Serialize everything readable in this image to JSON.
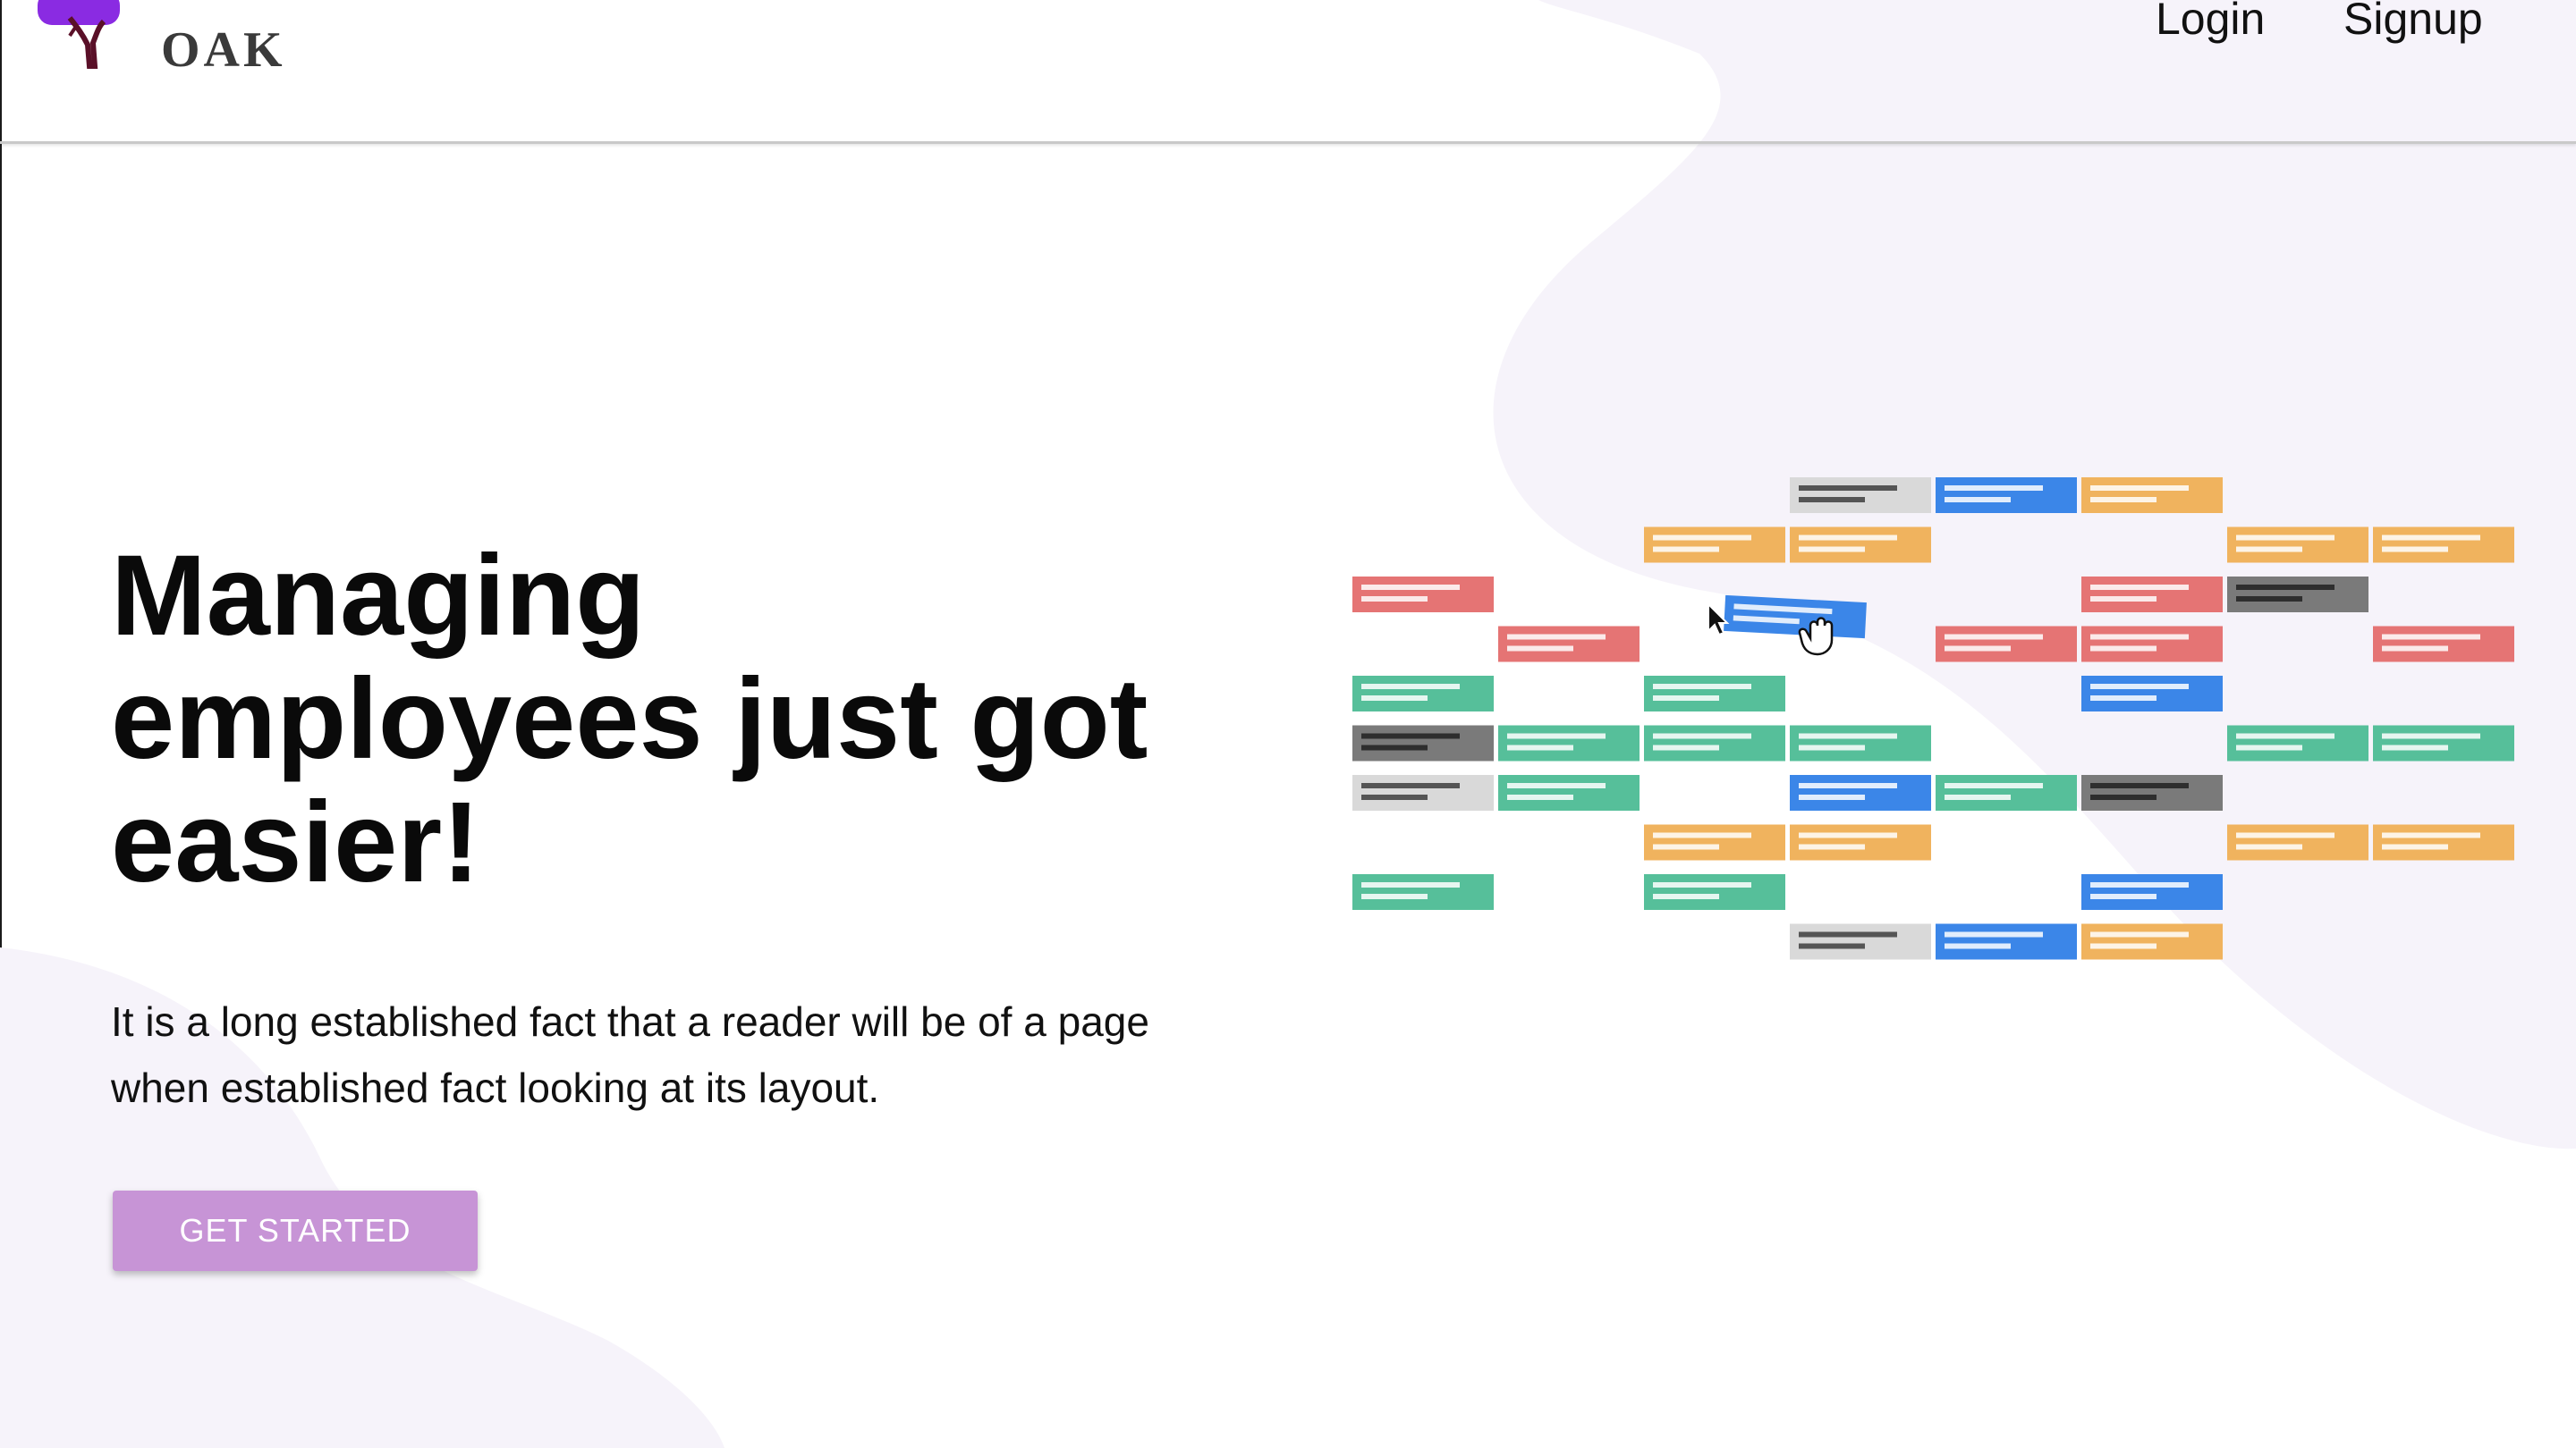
{
  "brand": {
    "name": "OAK",
    "accent_purple": "#8a2be2",
    "trunk_color": "#5a1028"
  },
  "nav": {
    "login_label": "Login",
    "signup_label": "Signup"
  },
  "hero": {
    "headline": "Managing employees just got easier!",
    "subtext": "It is a long established fact that a reader will be of a page when established fact looking at its layout.",
    "cta_label": "GET STARTED",
    "cta_color": "#c794d6"
  },
  "illustration": {
    "name": "shift-schedule-grid",
    "palette": {
      "blue": "#3b86e8",
      "orange": "#f0b35e",
      "red": "#e57474",
      "green": "#56bf9a",
      "dark": "#7a7a7a",
      "light": "#d9d9d9"
    },
    "columns": 8,
    "rows": 10,
    "cells": [
      [
        3,
        0,
        "light"
      ],
      [
        4,
        0,
        "blue"
      ],
      [
        5,
        0,
        "orange"
      ],
      [
        2,
        1,
        "orange"
      ],
      [
        3,
        1,
        "orange"
      ],
      [
        6,
        1,
        "orange"
      ],
      [
        7,
        1,
        "orange"
      ],
      [
        0,
        2,
        "red"
      ],
      [
        5,
        2,
        "red"
      ],
      [
        6,
        2,
        "dark"
      ],
      [
        1,
        3,
        "red"
      ],
      [
        4,
        3,
        "red"
      ],
      [
        5,
        3,
        "red"
      ],
      [
        7,
        3,
        "red"
      ],
      [
        0,
        4,
        "green"
      ],
      [
        2,
        4,
        "green"
      ],
      [
        5,
        4,
        "blue"
      ],
      [
        0,
        5,
        "dark"
      ],
      [
        1,
        5,
        "green"
      ],
      [
        2,
        5,
        "green"
      ],
      [
        3,
        5,
        "green"
      ],
      [
        6,
        5,
        "green"
      ],
      [
        7,
        5,
        "green"
      ],
      [
        0,
        6,
        "light"
      ],
      [
        1,
        6,
        "green"
      ],
      [
        3,
        6,
        "blue"
      ],
      [
        4,
        6,
        "green"
      ],
      [
        5,
        6,
        "dark"
      ],
      [
        2,
        7,
        "orange"
      ],
      [
        3,
        7,
        "orange"
      ],
      [
        6,
        7,
        "orange"
      ],
      [
        7,
        7,
        "orange"
      ],
      [
        0,
        8,
        "green"
      ],
      [
        2,
        8,
        "green"
      ],
      [
        5,
        8,
        "blue"
      ],
      [
        3,
        9,
        "light"
      ],
      [
        4,
        9,
        "blue"
      ],
      [
        5,
        9,
        "orange"
      ]
    ],
    "dragged_card_color": "blue",
    "cursor_icons": [
      "arrow-cursor-icon",
      "grab-hand-icon"
    ]
  }
}
